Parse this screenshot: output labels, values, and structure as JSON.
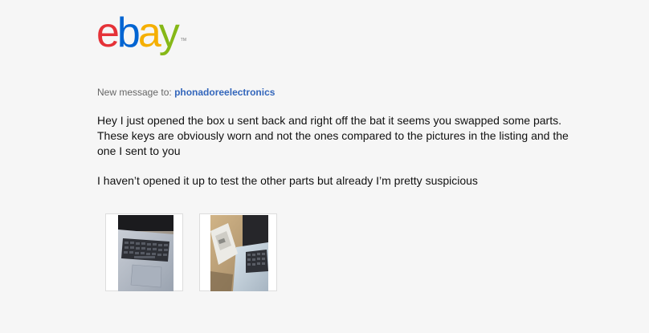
{
  "brand": {
    "logo_letters": [
      "e",
      "b",
      "a",
      "y"
    ],
    "logo_colors": [
      "#e53238",
      "#0064d2",
      "#f5af02",
      "#86b817"
    ],
    "trademark": "TM"
  },
  "header": {
    "recipient_prefix": "New message to:",
    "recipient_name": "phonadoreelectronics"
  },
  "message": {
    "paragraphs": [
      "Hey I just opened the box u sent back and right off the bat it seems you swapped some parts. These keys are obviously worn and not the ones compared to the pictures in the listing and the one I sent to you",
      "I haven’t opened it up to test the other parts but already I’m pretty suspicious"
    ]
  },
  "attachments": [
    {
      "name": "photo-laptop-keyboard"
    },
    {
      "name": "photo-laptop-with-box"
    }
  ]
}
